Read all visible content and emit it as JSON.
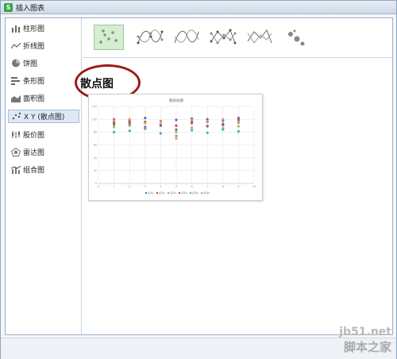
{
  "window": {
    "title": "插入图表"
  },
  "sidebar": {
    "items": [
      {
        "label": "柱形图",
        "icon": "column-chart-icon"
      },
      {
        "label": "折线图",
        "icon": "line-chart-icon"
      },
      {
        "label": "饼图",
        "icon": "pie-chart-icon"
      },
      {
        "label": "条形图",
        "icon": "bar-chart-icon"
      },
      {
        "label": "面积图",
        "icon": "area-chart-icon"
      },
      {
        "label": "X Y (散点图)",
        "icon": "scatter-chart-icon",
        "selected": true
      },
      {
        "label": "股价图",
        "icon": "stock-chart-icon"
      },
      {
        "label": "雷达图",
        "icon": "radar-chart-icon"
      },
      {
        "label": "组合图",
        "icon": "combo-chart-icon"
      }
    ]
  },
  "subtypes": {
    "selected_title": "散点图",
    "items": [
      {
        "icon": "scatter-markers-icon",
        "selected": true
      },
      {
        "icon": "scatter-smooth-lines-markers-icon"
      },
      {
        "icon": "scatter-smooth-lines-icon"
      },
      {
        "icon": "scatter-straight-lines-markers-icon"
      },
      {
        "icon": "scatter-straight-lines-icon"
      },
      {
        "icon": "bubble-icon"
      }
    ]
  },
  "preview": {
    "chart_data": {
      "type": "scatter",
      "title": "图表标题",
      "xlim": [
        0,
        10
      ],
      "ylim": [
        0,
        120
      ],
      "xticks": [
        "0",
        "1",
        "2",
        "3",
        "4",
        "5",
        "6",
        "7",
        "8",
        "9",
        "10"
      ],
      "yticks": [
        "0",
        "20",
        "40",
        "60",
        "80",
        "100",
        "120"
      ],
      "series": [
        {
          "name": "系列1",
          "color": "#4472c4",
          "x": [
            1,
            2,
            3,
            4,
            5,
            6,
            7,
            8,
            9
          ],
          "y": [
            100,
            98,
            102,
            97,
            99,
            101,
            100,
            98,
            102
          ]
        },
        {
          "name": "系列2",
          "color": "#c0504d",
          "x": [
            1,
            2,
            3,
            4,
            5,
            6,
            7,
            8,
            9
          ],
          "y": [
            95,
            93,
            96,
            92,
            90,
            94,
            96,
            91,
            95
          ]
        },
        {
          "name": "系列3",
          "color": "#9bbb59",
          "x": [
            1,
            2,
            3,
            4,
            5,
            6,
            7,
            8,
            9
          ],
          "y": [
            88,
            90,
            85,
            92,
            80,
            87,
            90,
            86,
            89
          ]
        },
        {
          "name": "系列4",
          "color": "#8064a2",
          "x": [
            1,
            2,
            3,
            4,
            5,
            6,
            7,
            8,
            9
          ],
          "y": [
            92,
            96,
            88,
            90,
            84,
            97,
            89,
            93,
            99
          ]
        },
        {
          "name": "系列5",
          "color": "#4bacc6",
          "x": [
            1,
            2,
            3,
            4,
            5,
            6,
            7,
            8,
            9
          ],
          "y": [
            80,
            82,
            86,
            78,
            74,
            83,
            79,
            84,
            81
          ]
        },
        {
          "name": "系列6",
          "color": "#f79646",
          "x": [
            1,
            2,
            3,
            4,
            5,
            6,
            7,
            8,
            9
          ],
          "y": [
            98,
            100,
            94,
            96,
            70,
            99,
            97,
            100,
            96
          ]
        }
      ]
    }
  },
  "watermark": {
    "url": "jb51.net",
    "name": "脚本之家"
  }
}
